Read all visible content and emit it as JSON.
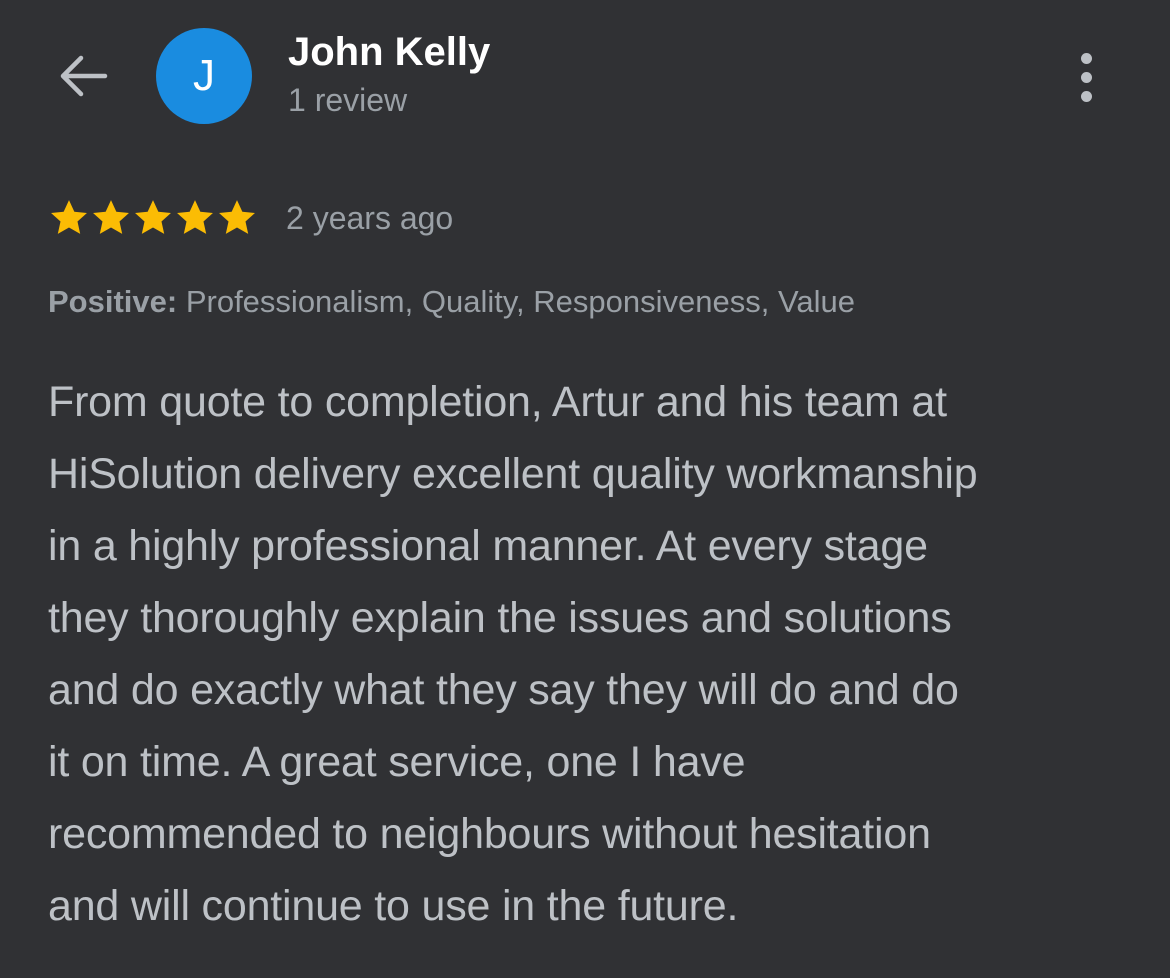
{
  "header": {
    "back_icon": "arrow-left-icon",
    "avatar_letter": "J",
    "avatar_color": "#1a8ce0",
    "reviewer_name": "John Kelly",
    "review_count": "1 review",
    "more_icon": "more-vertical-icon"
  },
  "rating": {
    "stars": 5,
    "max_stars": 5,
    "star_color": "#fbbc04",
    "date": "2 years ago"
  },
  "highlights": {
    "label": "Positive:",
    "value": " Professionalism, Quality, Responsiveness, Value"
  },
  "review": {
    "lines": [
      "From quote to completion, Artur and his team at",
      "HiSolution delivery excellent quality workmanship",
      "in a highly professional manner. At every stage",
      "they thoroughly explain the issues and solutions",
      "and do exactly what they say they will do and do",
      "it on time. A great service, one I have",
      "recommended to neighbours without hesitation",
      "and will continue to use in the future."
    ]
  }
}
